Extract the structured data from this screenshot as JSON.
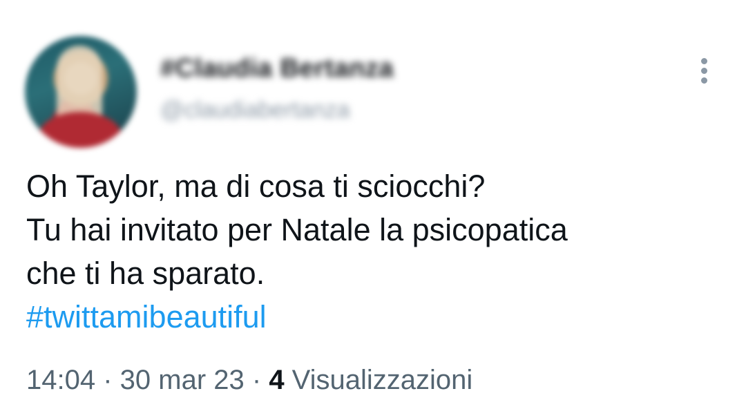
{
  "author": {
    "display_name": "#Claudia Bertanza",
    "handle": "@claudiabertanza"
  },
  "tweet": {
    "lines": [
      "Oh Taylor, ma di cosa ti sciocchi?",
      "Tu hai invitato per Natale la psicopatica",
      "che ti ha sparato."
    ],
    "hashtag": "#twittamibeautiful"
  },
  "meta": {
    "time": "14:04",
    "separator1": " · ",
    "date": "30 mar 23",
    "separator2": " · ",
    "views_count": "4",
    "views_label": " Visualizzazioni"
  },
  "icons": {
    "more": "more-vertical-icon"
  },
  "colors": {
    "text": "#0f1419",
    "secondary": "#536471",
    "link": "#1d9bf0"
  }
}
